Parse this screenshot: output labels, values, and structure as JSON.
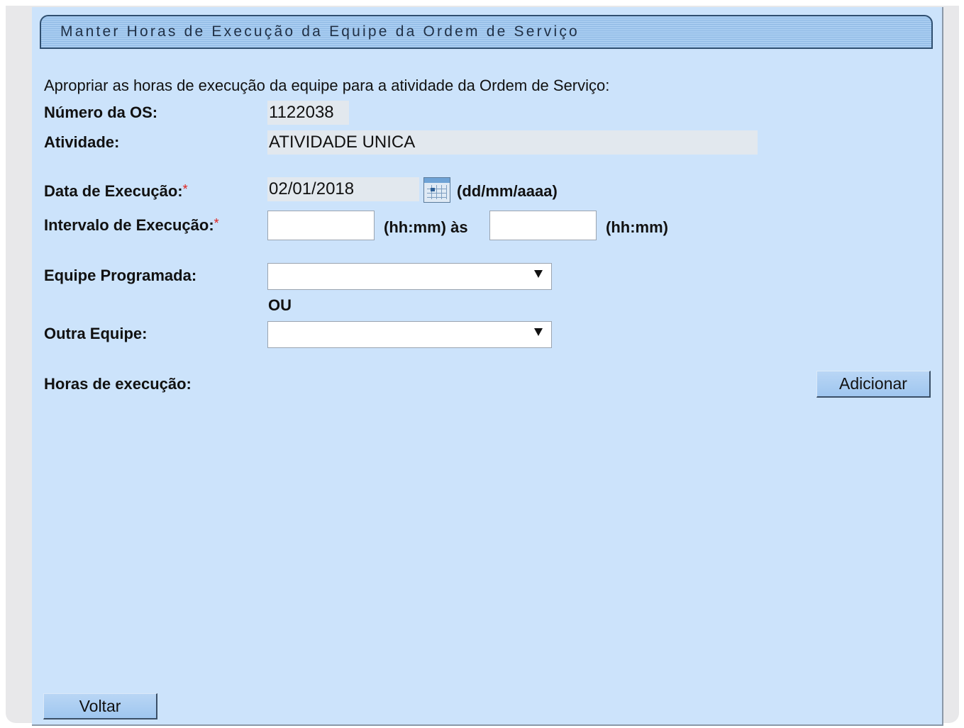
{
  "header": {
    "title": "Manter Horas de Execução da Equipe da Ordem de Serviço"
  },
  "form": {
    "intro": "Apropriar as horas de execução da equipe para a atividade da Ordem de Serviço:",
    "numero_os": {
      "label": "Número da OS:",
      "value": "1122038"
    },
    "atividade": {
      "label": "Atividade:",
      "value": "ATIVIDADE UNICA"
    },
    "data_execucao": {
      "label": "Data de Execução:",
      "required_mark": "*",
      "value": "02/01/2018",
      "format_hint": "(dd/mm/aaaa)",
      "icon": "calendar-icon"
    },
    "intervalo_execucao": {
      "label": "Intervalo de Execução:",
      "required_mark": "*",
      "start_value": "",
      "start_hint": "(hh:mm) às",
      "end_value": "",
      "end_hint": "(hh:mm)"
    },
    "equipe_programada": {
      "label": "Equipe Programada:",
      "selected": ""
    },
    "separator": "OU",
    "outra_equipe": {
      "label": "Outra Equipe:",
      "selected": ""
    },
    "horas_execucao": {
      "label": "Horas de execução:",
      "add_button": "Adicionar"
    }
  },
  "footer": {
    "back_button": "Voltar"
  },
  "colors": {
    "panel_bg": "#cce3fb",
    "title_bar": "#a9cdf1",
    "required": "#e0201a",
    "button": "#a9cdf1"
  }
}
